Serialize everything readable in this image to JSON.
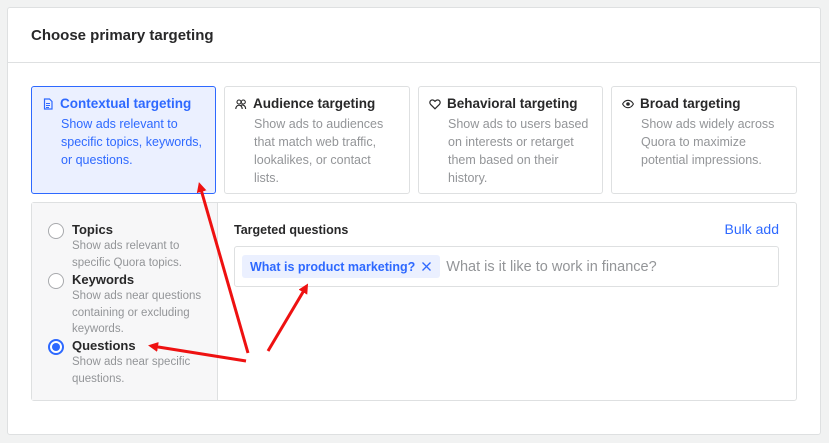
{
  "header": {
    "title": "Choose primary targeting"
  },
  "targeting_options": [
    {
      "id": "contextual",
      "title": "Contextual targeting",
      "icon": "document-icon",
      "description": "Show ads relevant to specific topics, keywords, or questions.",
      "selected": true
    },
    {
      "id": "audience",
      "title": "Audience targeting",
      "icon": "people-icon",
      "description": "Show ads to audiences that match web traffic, lookalikes, or contact lists.",
      "selected": false
    },
    {
      "id": "behavioral",
      "title": "Behavioral targeting",
      "icon": "heart-icon",
      "description": "Show ads to users based on interests or retarget them based on their history.",
      "selected": false
    },
    {
      "id": "broad",
      "title": "Broad targeting",
      "icon": "eye-icon",
      "description": "Show ads widely across Quora to maximize potential impressions.",
      "selected": false
    }
  ],
  "contextual_types": [
    {
      "label": "Topics",
      "description": "Show ads relevant to specific Quora topics.",
      "checked": false
    },
    {
      "label": "Keywords",
      "description": "Show ads near questions containing or excluding keywords.",
      "checked": false
    },
    {
      "label": "Questions",
      "description": "Show ads near specific questions.",
      "checked": true
    }
  ],
  "targeted_questions": {
    "label": "Targeted questions",
    "bulk_add": "Bulk add",
    "tags": [
      "What is product marketing?"
    ],
    "placeholder": "What is it like to work in finance?"
  },
  "colors": {
    "accent": "#2e69ff",
    "selected_bg": "#ebf0ff",
    "annotation_arrow": "#ee1111"
  }
}
